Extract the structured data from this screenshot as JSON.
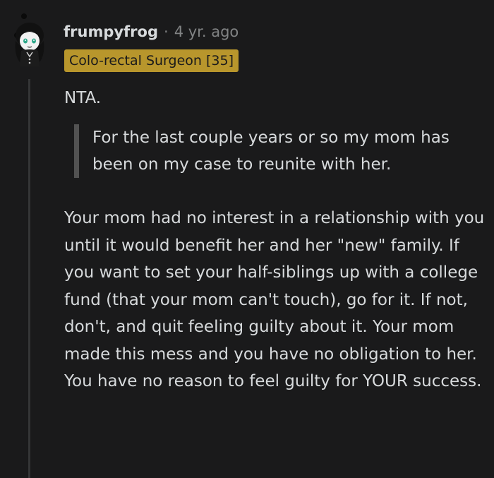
{
  "comment": {
    "username": "frumpyfrog",
    "separator": "·",
    "age": "4 yr. ago",
    "flair": "Colo-rectal Surgeon [35]",
    "verdict": "NTA.",
    "quote": "For the last couple years or so my mom has been on my case to reunite with her.",
    "body": "Your mom had no interest in a relationship with you until it would benefit her and her \"new\" family. If you want to set your half-siblings up with a college fund (that your mom can't touch), go for it. If not, don't, and quit feeling guilty about it. Your mom made this mess and you have no obligation to her. You have no reason to feel guilty for YOUR success."
  },
  "colors": {
    "background": "#1a1a1b",
    "text": "#d7dadc",
    "meta": "#818384",
    "flair_bg": "#b8962c",
    "quote_bar": "#525252",
    "thread_line": "#343536"
  },
  "icons": {
    "avatar": "snoo-avatar-icon"
  }
}
